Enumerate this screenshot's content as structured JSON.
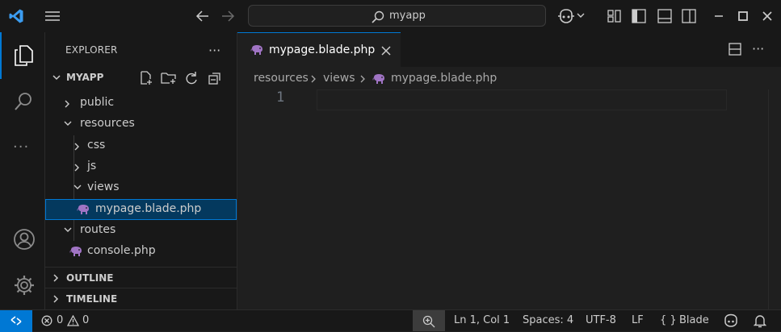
{
  "titlebar": {
    "search_text": "myapp",
    "icons": [
      "vscode-logo-icon",
      "menu-icon",
      "back-arrow-icon",
      "forward-arrow-icon",
      "search-icon",
      "copilot-icon",
      "chevron-down-icon",
      "customize-layout-icon",
      "toggle-primary-sidebar-icon",
      "toggle-panel-icon",
      "toggle-secondary-sidebar-icon",
      "minimize-icon",
      "maximize-icon",
      "close-icon"
    ]
  },
  "activitybar": {
    "items": [
      "explorer-icon",
      "search-icon",
      "more-icon",
      "accounts-icon",
      "manage-gear-icon"
    ],
    "more_label": "···"
  },
  "sidebar": {
    "title": "EXPLORER",
    "more_label": "···",
    "folder": "MYAPP",
    "tree": [
      {
        "label": "public",
        "type": "folder",
        "expanded": false
      },
      {
        "label": "resources",
        "type": "folder",
        "expanded": true
      },
      {
        "label": "css",
        "type": "folder",
        "expanded": false
      },
      {
        "label": "js",
        "type": "folder",
        "expanded": false
      },
      {
        "label": "views",
        "type": "folder",
        "expanded": true
      },
      {
        "label": "mypage.blade.php",
        "type": "file",
        "selected": true
      },
      {
        "label": "routes",
        "type": "folder",
        "expanded": true
      },
      {
        "label": "console.php",
        "type": "file"
      }
    ],
    "outline": "OUTLINE",
    "timeline": "TIMELINE"
  },
  "editor": {
    "tab_label": "mypage.blade.php",
    "breadcrumb": [
      "resources",
      "views",
      "mypage.blade.php"
    ],
    "line_number": "1",
    "more_label": "···"
  },
  "statusbar": {
    "errors": "0",
    "warnings": "0",
    "position": "Ln 1, Col 1",
    "spaces": "Spaces: 4",
    "encoding": "UTF-8",
    "eol": "LF",
    "language": "Blade",
    "language_braces": "{ }"
  },
  "colors": {
    "accent": "#0078d4",
    "background": "#1f1f1f",
    "sidebar": "#181818",
    "selection": "#04395e",
    "php_icon": "#a074c4"
  }
}
